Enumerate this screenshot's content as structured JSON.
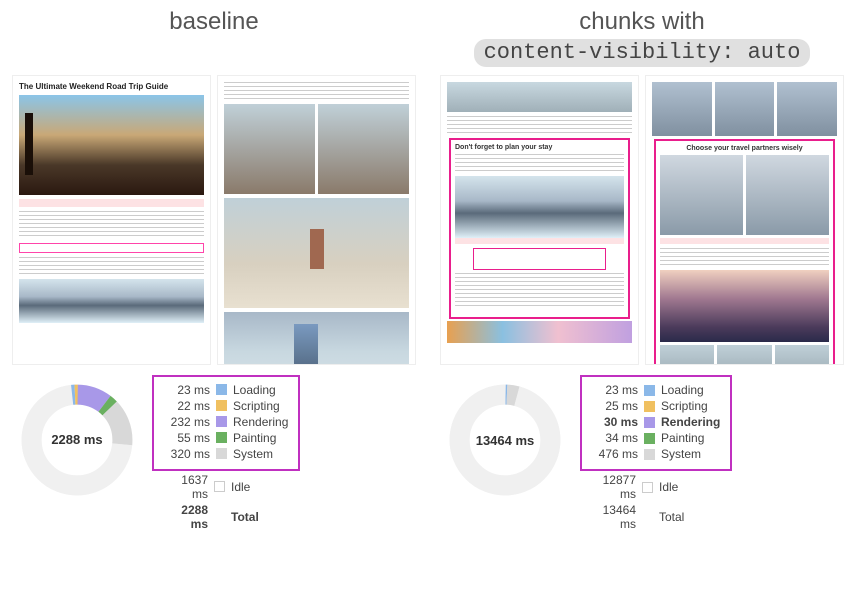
{
  "left": {
    "header": "baseline",
    "articleTitle": "The Ultimate Weekend Road Trip Guide",
    "donutCenter": "2288 ms",
    "donut": {
      "segments": [
        {
          "color": "#a898e8",
          "pct": 10.14
        },
        {
          "color": "#6ab060",
          "pct": 2.4
        },
        {
          "color": "#d8d8d8",
          "pct": 13.99
        },
        {
          "color": "#f0f0f0",
          "pct": 71.55
        },
        {
          "color": "#8bb8e8",
          "pct": 1.0
        },
        {
          "color": "#f0c060",
          "pct": 0.96
        }
      ]
    },
    "legend": [
      {
        "ms": "23 ms",
        "swatch": "sw-load",
        "label": "Loading"
      },
      {
        "ms": "22 ms",
        "swatch": "sw-script",
        "label": "Scripting"
      },
      {
        "ms": "232 ms",
        "swatch": "sw-render",
        "label": "Rendering"
      },
      {
        "ms": "55 ms",
        "swatch": "sw-paint",
        "label": "Painting"
      },
      {
        "ms": "320 ms",
        "swatch": "sw-system",
        "label": "System"
      }
    ],
    "outside": [
      {
        "ms": "1637 ms",
        "swatch": "sw-idle",
        "label": "Idle",
        "bold": false
      },
      {
        "ms": "2288 ms",
        "swatch": "",
        "label": "Total",
        "bold": true
      }
    ]
  },
  "right": {
    "headerLine1": "chunks with",
    "headerLine2": "content-visibility: auto",
    "sub1": "Don't forget to plan your stay",
    "sub2": "Choose your travel partners wisely",
    "donutCenter": "13464 ms",
    "donut": {
      "segments": [
        {
          "color": "#8bb8e8",
          "pct": 0.5
        },
        {
          "color": "#d8d8d8",
          "pct": 3.54
        },
        {
          "color": "#f0f0f0",
          "pct": 95.96
        }
      ]
    },
    "legend": [
      {
        "ms": "23 ms",
        "swatch": "sw-load",
        "label": "Loading",
        "bold": false
      },
      {
        "ms": "25 ms",
        "swatch": "sw-script",
        "label": "Scripting",
        "bold": false
      },
      {
        "ms": "30 ms",
        "swatch": "sw-render",
        "label": "Rendering",
        "bold": true
      },
      {
        "ms": "34 ms",
        "swatch": "sw-paint",
        "label": "Painting",
        "bold": false
      },
      {
        "ms": "476 ms",
        "swatch": "sw-system",
        "label": "System",
        "bold": false
      }
    ],
    "outside": [
      {
        "ms": "12877 ms",
        "swatch": "sw-idle",
        "label": "Idle",
        "bold": false
      },
      {
        "ms": "13464 ms",
        "swatch": "",
        "label": "Total",
        "bold": false
      }
    ]
  },
  "chart_data": [
    {
      "type": "pie",
      "title": "baseline timing breakdown",
      "series": [
        {
          "name": "Loading",
          "value": 23,
          "unit": "ms"
        },
        {
          "name": "Scripting",
          "value": 22,
          "unit": "ms"
        },
        {
          "name": "Rendering",
          "value": 232,
          "unit": "ms"
        },
        {
          "name": "Painting",
          "value": 55,
          "unit": "ms"
        },
        {
          "name": "System",
          "value": 320,
          "unit": "ms"
        },
        {
          "name": "Idle",
          "value": 1637,
          "unit": "ms"
        }
      ],
      "total": 2288
    },
    {
      "type": "pie",
      "title": "content-visibility:auto timing breakdown",
      "series": [
        {
          "name": "Loading",
          "value": 23,
          "unit": "ms"
        },
        {
          "name": "Scripting",
          "value": 25,
          "unit": "ms"
        },
        {
          "name": "Rendering",
          "value": 30,
          "unit": "ms"
        },
        {
          "name": "Painting",
          "value": 34,
          "unit": "ms"
        },
        {
          "name": "System",
          "value": 476,
          "unit": "ms"
        },
        {
          "name": "Idle",
          "value": 12877,
          "unit": "ms"
        }
      ],
      "total": 13464
    }
  ]
}
